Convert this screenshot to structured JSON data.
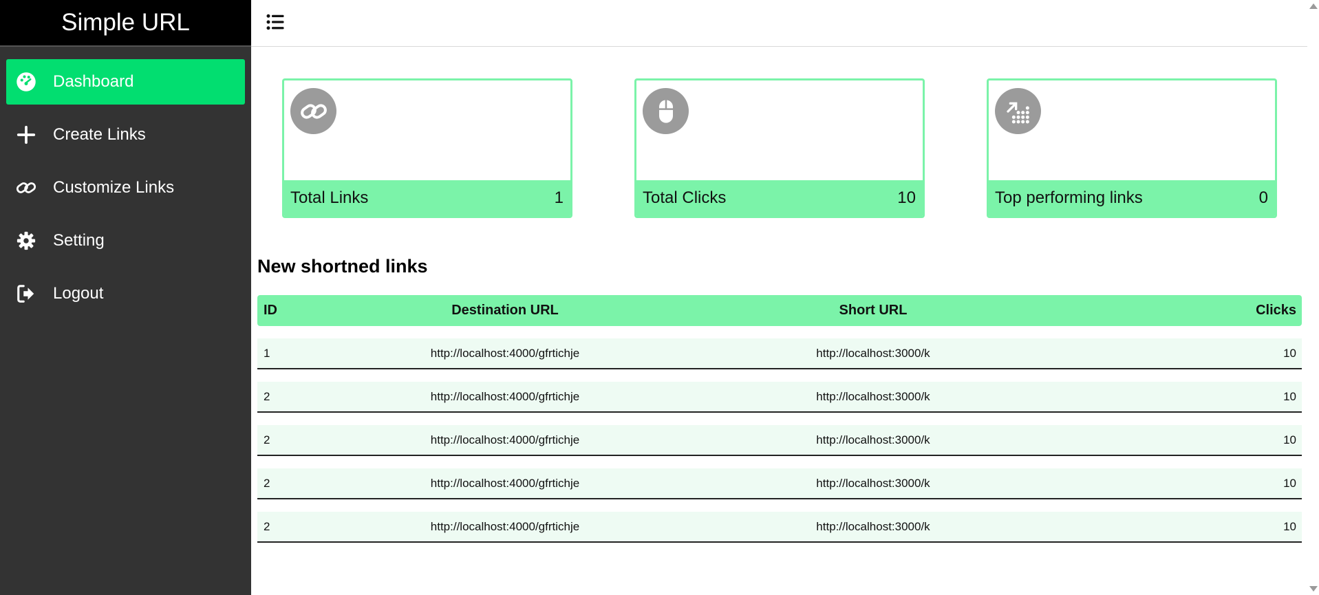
{
  "app": {
    "title": "Simple URL"
  },
  "sidebar": {
    "items": [
      {
        "label": "Dashboard",
        "icon": "palette-icon",
        "active": true
      },
      {
        "label": "Create Links",
        "icon": "plus-icon"
      },
      {
        "label": "Customize Links",
        "icon": "link-icon"
      },
      {
        "label": "Setting",
        "icon": "gear-icon"
      },
      {
        "label": "Logout",
        "icon": "logout-icon"
      }
    ]
  },
  "topbar": {
    "menu_icon": "list-icon"
  },
  "cards": [
    {
      "label": "Total Links",
      "value": "1",
      "icon": "link-icon"
    },
    {
      "label": "Total Clicks",
      "value": "10",
      "icon": "mouse-icon"
    },
    {
      "label": "Top performing links",
      "value": "0",
      "icon": "trend-up-icon"
    }
  ],
  "section": {
    "title": "New shortned links"
  },
  "table": {
    "headers": {
      "id": "ID",
      "dest": "Destination URL",
      "short": "Short URL",
      "clicks": "Clicks"
    },
    "rows": [
      {
        "id": "1",
        "dest": "http://localhost:4000/gfrtichje",
        "short": "http://localhost:3000/k",
        "clicks": "10"
      },
      {
        "id": "2",
        "dest": "http://localhost:4000/gfrtichje",
        "short": "http://localhost:3000/k",
        "clicks": "10"
      },
      {
        "id": "2",
        "dest": "http://localhost:4000/gfrtichje",
        "short": "http://localhost:3000/k",
        "clicks": "10"
      },
      {
        "id": "2",
        "dest": "http://localhost:4000/gfrtichje",
        "short": "http://localhost:3000/k",
        "clicks": "10"
      },
      {
        "id": "2",
        "dest": "http://localhost:4000/gfrtichje",
        "short": "http://localhost:3000/k",
        "clicks": "10"
      }
    ]
  },
  "colors": {
    "accent": "#02de70",
    "accent_light": "#7bf3a9",
    "sidebar": "#333333",
    "brand_bg": "#000000",
    "row_bg": "#eefbf3",
    "icon_bg": "#9b9b9b"
  }
}
